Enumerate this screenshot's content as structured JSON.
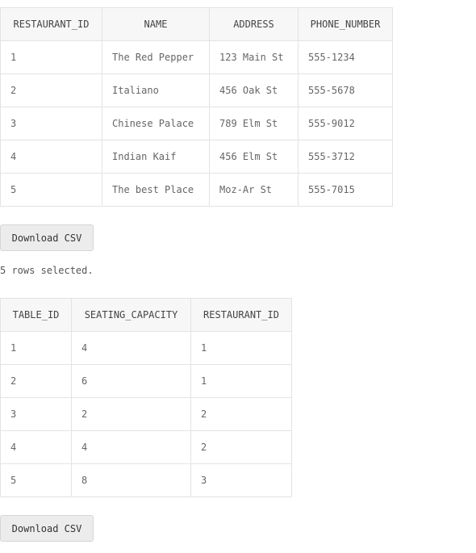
{
  "restaurants": {
    "columns": [
      "RESTAURANT_ID",
      "NAME",
      "ADDRESS",
      "PHONE_NUMBER"
    ],
    "rows": [
      [
        "1",
        "The Red Pepper",
        "123 Main St",
        "555-1234"
      ],
      [
        "2",
        "Italiano",
        "456 Oak St",
        "555-5678"
      ],
      [
        "3",
        "Chinese Palace",
        "789 Elm St",
        "555-9012"
      ],
      [
        "4",
        "Indian Kaif",
        "456 Elm St",
        "555-3712"
      ],
      [
        "5",
        "The best Place",
        "Moz-Ar St",
        "555-7015"
      ]
    ],
    "download_label": "Download CSV"
  },
  "status": {
    "rows_selected": "5 rows selected."
  },
  "tables": {
    "columns": [
      "TABLE_ID",
      "SEATING_CAPACITY",
      "RESTAURANT_ID"
    ],
    "rows": [
      [
        "1",
        "4",
        "1"
      ],
      [
        "2",
        "6",
        "1"
      ],
      [
        "3",
        "2",
        "2"
      ],
      [
        "4",
        "4",
        "2"
      ],
      [
        "5",
        "8",
        "3"
      ]
    ],
    "download_label": "Download CSV"
  }
}
